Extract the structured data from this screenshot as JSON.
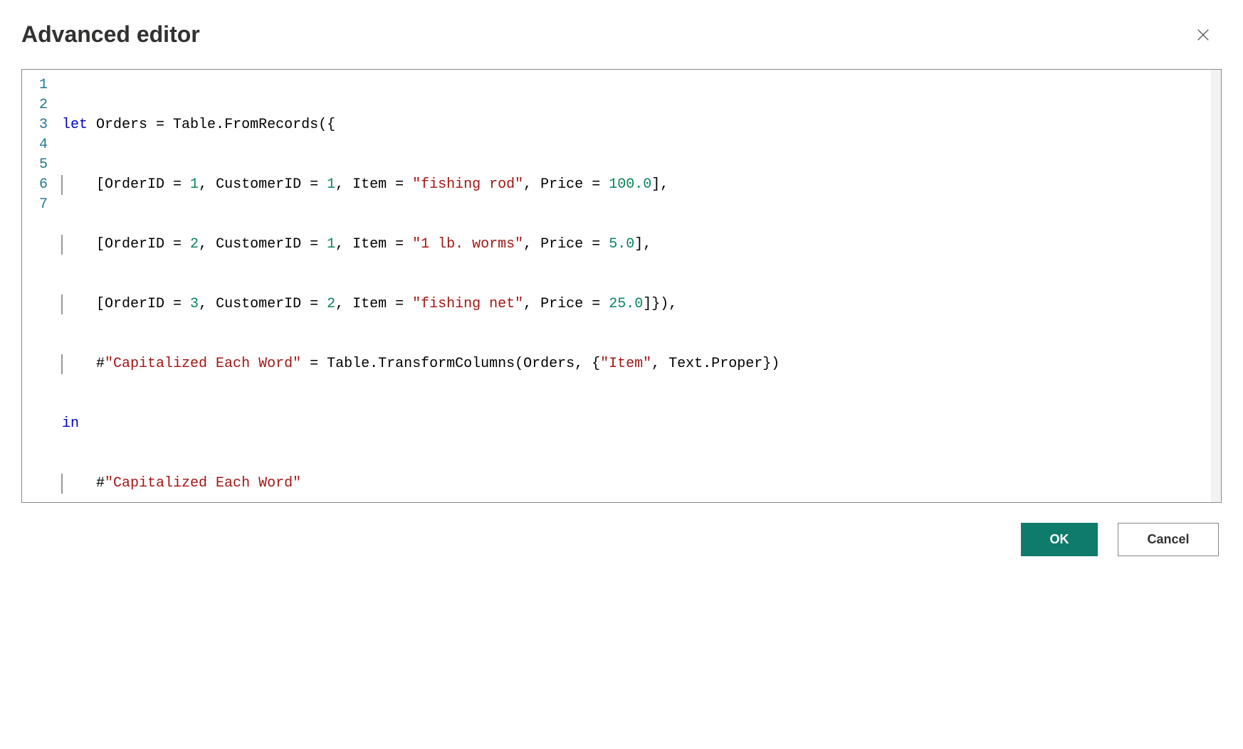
{
  "dialog": {
    "title": "Advanced editor"
  },
  "gutter": {
    "n1": "1",
    "n2": "2",
    "n3": "3",
    "n4": "4",
    "n5": "5",
    "n6": "6",
    "n7": "7"
  },
  "code": {
    "line1": {
      "kw_let": "let",
      "rest": " Orders = Table.FromRecords({"
    },
    "line2": {
      "indent": "    [OrderID = ",
      "num1": "1",
      "mid1": ", CustomerID = ",
      "num2": "1",
      "mid2": ", Item = ",
      "str1": "\"fishing rod\"",
      "mid3": ", Price = ",
      "num3": "100.0",
      "end": "],"
    },
    "line3": {
      "indent": "    [OrderID = ",
      "num1": "2",
      "mid1": ", CustomerID = ",
      "num2": "1",
      "mid2": ", Item = ",
      "str1": "\"1 lb. worms\"",
      "mid3": ", Price = ",
      "num3": "5.0",
      "end": "],"
    },
    "line4": {
      "indent": "    [OrderID = ",
      "num1": "3",
      "mid1": ", CustomerID = ",
      "num2": "2",
      "mid2": ", Item = ",
      "str1": "\"fishing net\"",
      "mid3": ", Price = ",
      "num3": "25.0",
      "end": "]}),"
    },
    "line5": {
      "indent": "    #",
      "str1": "\"Capitalized Each Word\"",
      "mid1": " = Table.TransformColumns(Orders, {",
      "str2": "\"Item\"",
      "end": ", Text.Proper})"
    },
    "line6": {
      "kw_in": "in"
    },
    "line7": {
      "indent": "    #",
      "str1": "\"Capitalized Each Word\""
    }
  },
  "buttons": {
    "ok": "OK",
    "cancel": "Cancel"
  }
}
